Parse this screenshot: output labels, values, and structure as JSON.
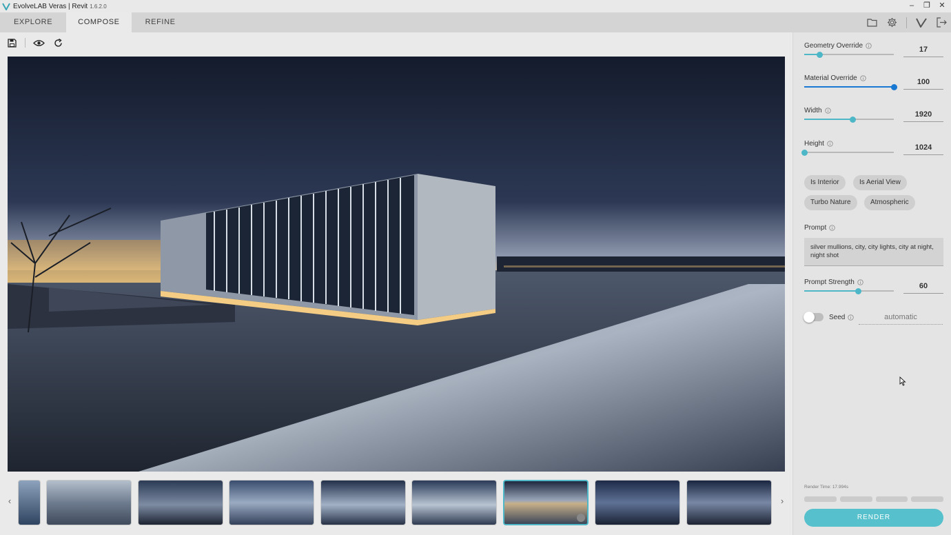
{
  "titlebar": {
    "title": "EvolveLAB Veras | Revit",
    "version": "1.6.2.0"
  },
  "tabs": [
    {
      "label": "EXPLORE"
    },
    {
      "label": "COMPOSE"
    },
    {
      "label": "REFINE"
    }
  ],
  "icons": {
    "folder": "folder-icon",
    "settings": "gear-icon",
    "veras": "veras-logo-icon",
    "exit": "exit-icon",
    "save": "save-icon",
    "eye": "eye-icon",
    "refresh": "refresh-icon"
  },
  "controls": {
    "geometry_override": {
      "label": "Geometry Override",
      "value": "17",
      "level": 0.17
    },
    "material_override": {
      "label": "Material Override",
      "value": "100",
      "level": 1.0
    },
    "width": {
      "label": "Width",
      "value": "1920",
      "level": 0.54
    },
    "height": {
      "label": "Height",
      "value": "1024",
      "level": 0.0
    },
    "prompt_strength": {
      "label": "Prompt Strength",
      "value": "60",
      "level": 0.6
    }
  },
  "chips": [
    {
      "label": "Is Interior"
    },
    {
      "label": "Is Aerial View"
    },
    {
      "label": "Turbo Nature"
    },
    {
      "label": "Atmospheric"
    }
  ],
  "prompt": {
    "label": "Prompt",
    "text": "silver mullions, city, city lights, city at night, night shot"
  },
  "seed": {
    "label": "Seed",
    "value": "automatic",
    "enabled": false
  },
  "render": {
    "time_label": "Render Time: 17.994s",
    "button_label": "RENDER"
  },
  "colors": {
    "accent": "#4db7c7",
    "blue": "#1978d1",
    "render_button": "#56c0cc"
  }
}
